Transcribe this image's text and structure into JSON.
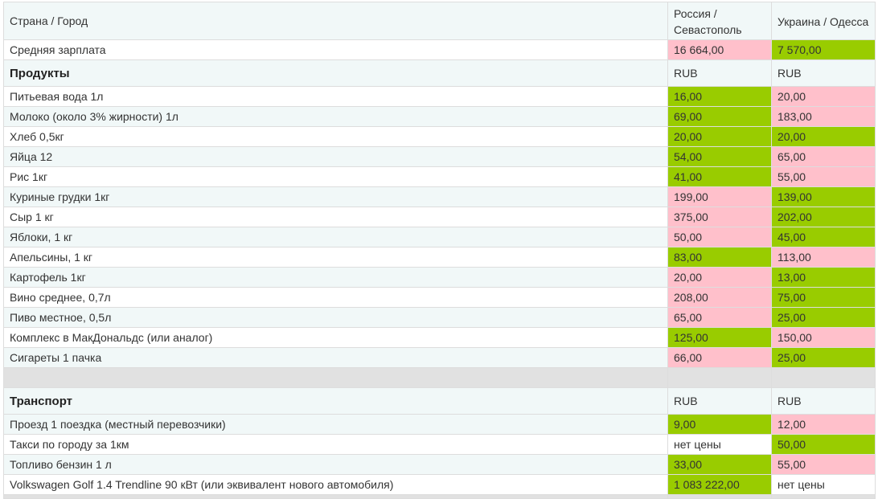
{
  "header": {
    "label": "Страна / Город",
    "col1": "Россия / Севастополь",
    "col2": "Украина / Одесса"
  },
  "salary": {
    "label": "Средняя зарплата",
    "col1": "16 664,00",
    "col2": "7 570,00"
  },
  "products": {
    "title": "Продукты",
    "currency1": "RUB",
    "currency2": "RUB",
    "rows": [
      {
        "label": "Питьевая вода 1л",
        "col1": "16,00",
        "col2": "20,00"
      },
      {
        "label": "Молоко (около 3% жирности) 1л",
        "col1": "69,00",
        "col2": "183,00"
      },
      {
        "label": "Хлеб 0,5кг",
        "col1": "20,00",
        "col2": "20,00"
      },
      {
        "label": "Яйца 12",
        "col1": "54,00",
        "col2": "65,00"
      },
      {
        "label": "Рис 1кг",
        "col1": "41,00",
        "col2": "55,00"
      },
      {
        "label": "Куриные грудки 1кг",
        "col1": "199,00",
        "col2": "139,00"
      },
      {
        "label": "Сыр 1 кг",
        "col1": "375,00",
        "col2": "202,00"
      },
      {
        "label": "Яблоки, 1 кг",
        "col1": "50,00",
        "col2": "45,00"
      },
      {
        "label": "Апельсины, 1 кг",
        "col1": "83,00",
        "col2": "113,00"
      },
      {
        "label": "Картофель 1кг",
        "col1": "20,00",
        "col2": "13,00"
      },
      {
        "label": "Вино среднее, 0,7л",
        "col1": "208,00",
        "col2": "75,00"
      },
      {
        "label": "Пиво местное, 0,5л",
        "col1": "65,00",
        "col2": "25,00"
      },
      {
        "label": "Комплекс в МакДональдс (или аналог)",
        "col1": "125,00",
        "col2": "150,00"
      },
      {
        "label": "Сигареты 1 пачка",
        "col1": "66,00",
        "col2": "25,00"
      }
    ]
  },
  "transport": {
    "title": "Транспорт",
    "currency1": "RUB",
    "currency2": "RUB",
    "rows": [
      {
        "label": "Проезд 1 поездка (местный перевозчики)",
        "col1": "9,00",
        "col2": "12,00"
      },
      {
        "label": "Такси по городу за 1км",
        "col1": "нет цены",
        "col2": "50,00"
      },
      {
        "label": "Топливо бензин 1 л",
        "col1": "33,00",
        "col2": "55,00"
      },
      {
        "label": "Volkswagen Golf 1.4 Trendline 90 кВт (или эквивалент нового автомобиля)",
        "col1": "1 083 222,00",
        "col2": "нет цены"
      }
    ]
  },
  "colors": {
    "cheaper": "#99cc00",
    "pricier": "#ffc0cb",
    "row_tint": "#f1f8f8",
    "spacer": "#e1e1e1"
  }
}
